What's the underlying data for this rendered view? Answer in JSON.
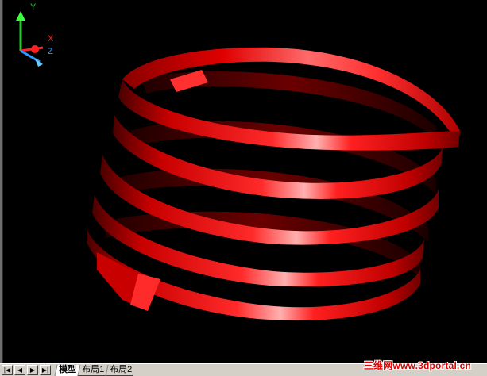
{
  "viewport": {
    "background": "#000000",
    "object": "red-helical-spring-ribbon",
    "object_color": "#ff0000"
  },
  "ucs": {
    "y_label": "Y",
    "x_label": "X",
    "z_label": "Z",
    "y_color": "#22cc22",
    "x_color": "#ff2020",
    "z_color": "#3399ff"
  },
  "nav": {
    "first": "|◀",
    "prev": "◀",
    "next": "▶",
    "last": "▶|"
  },
  "tabs": [
    {
      "label": "模型",
      "active": true
    },
    {
      "label": "布局1",
      "active": false
    },
    {
      "label": "布局2",
      "active": false
    }
  ],
  "watermark": "三维网www.3dportal.cn"
}
